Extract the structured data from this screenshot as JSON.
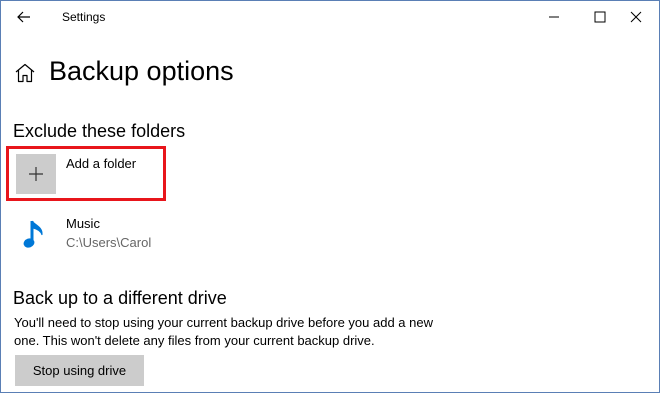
{
  "window": {
    "title": "Settings"
  },
  "page": {
    "title": "Backup options"
  },
  "exclude": {
    "heading": "Exclude these folders",
    "add_label": "Add a folder",
    "folders": [
      {
        "name": "Music",
        "path": "C:\\Users\\Carol",
        "icon": "music-note-icon"
      }
    ]
  },
  "drive": {
    "heading": "Back up to a different drive",
    "description": "You'll need to stop using your current backup drive before you add a new one. This won't delete any files from your current backup drive.",
    "stop_label": "Stop using drive"
  },
  "colors": {
    "accent": "#0078d7",
    "highlight": "#e8151b",
    "tile": "#cccccc"
  }
}
